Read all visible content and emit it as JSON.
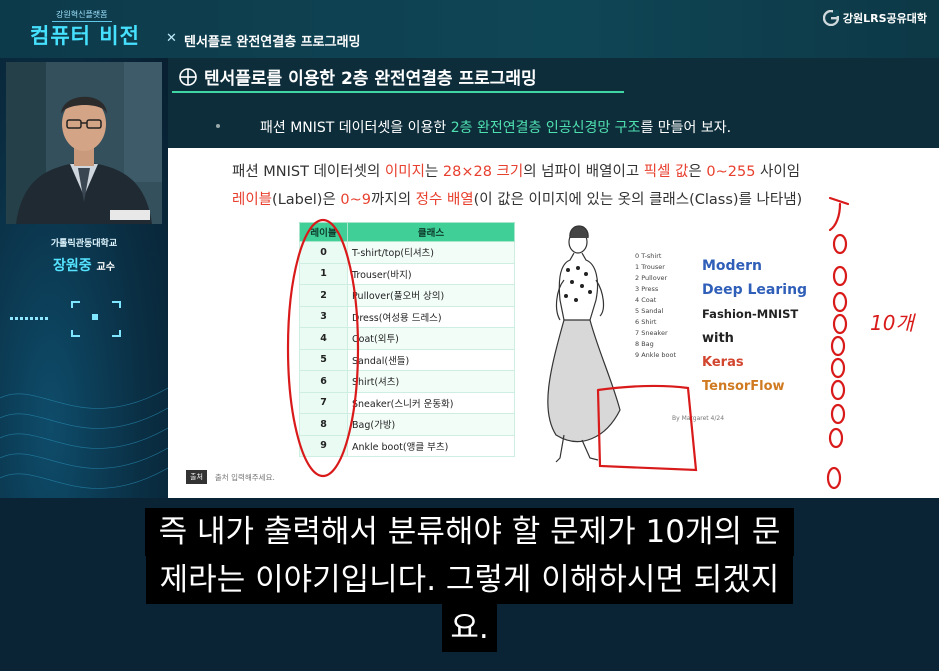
{
  "header": {
    "brand_small": "강원혁신플랫폼",
    "brand_big": "컴퓨터 비전",
    "lecture_prefix": "✕",
    "lecture_title": "텐서플로 완전연결층 프로그래밍",
    "org_name": "강원LRS공유대학",
    "org_icon": "g-logo-icon"
  },
  "presenter": {
    "university": "가톨릭관동대학교",
    "name": "장원중",
    "title_suffix": "교수"
  },
  "slide": {
    "title": "텐서플로를 이용한 2층 완전연결층 프로그래밍",
    "intro_before": "패션 MNIST 데이터셋을 이용한 ",
    "intro_hl": "2층 완전연결층 인공신경망 구조",
    "intro_after": "를 만들어 보자.",
    "desc1": {
      "a": "패션 MNIST 데이터셋의 ",
      "b": "이미지",
      "c": "는 ",
      "d": "28×28 크기",
      "e": "의 넘파이 배열이고 ",
      "f": "픽셀 값",
      "g": "은 ",
      "h": "0~255",
      "i": " 사이임"
    },
    "desc2": {
      "a": "레이블",
      "b": "(Label)은 ",
      "c": "0~9",
      "d": "까지의 ",
      "e": "정수 배열",
      "f": "(이 값은 이미지에 있는 옷의 클래스(Class)를 나타냄)"
    },
    "table": {
      "headers": [
        "레이블",
        "클래스"
      ],
      "rows": [
        {
          "label": "0",
          "class": "T-shirt/top(티셔츠)"
        },
        {
          "label": "1",
          "class": "Trouser(바지)"
        },
        {
          "label": "2",
          "class": "Pullover(풀오버 상의)"
        },
        {
          "label": "3",
          "class": "Dress(여성용 드레스)"
        },
        {
          "label": "4",
          "class": "Coat(외투)"
        },
        {
          "label": "5",
          "class": "Sandal(샌들)"
        },
        {
          "label": "6",
          "class": "Shirt(셔츠)"
        },
        {
          "label": "7",
          "class": "Sneaker(스니커 운동화)"
        },
        {
          "label": "8",
          "class": "Bag(가방)"
        },
        {
          "label": "9",
          "class": "Ankle boot(앵클 부츠)"
        }
      ]
    },
    "sketch": {
      "small_list": [
        "0 T-shirt",
        "1 Trouser",
        "2 Pullover",
        "3 Press",
        "4 Coat",
        "5 Sandal",
        "6 Shirt",
        "7 Sneaker",
        "8 Bag",
        "9 Ankle boot"
      ],
      "words": [
        "Modern",
        "Deep Learing",
        "Fashion-MNIST",
        "with",
        "Keras",
        "TensorFlow"
      ],
      "word_colors": [
        "#2f5fb8",
        "#2f5fb8",
        "#222222",
        "#222222",
        "#d2452f",
        "#d07a22"
      ],
      "credit": "By Margaret 4/24"
    },
    "source_badge": "출처",
    "source_text": "출처 입력해주세요.",
    "annotation_text": "10개"
  },
  "subtitle": {
    "line1": "즉 내가 출력해서 분류해야 할 문제가 10개의 문",
    "line2": "제라는 이야기입니다. 그렇게 이해하시면 되겠지",
    "line3": "요."
  },
  "colors": {
    "accent": "#46e1ff",
    "highlight_green": "#4fe0b0",
    "highlight_red": "#e8402f",
    "table_header": "#3fcf97",
    "annotation_red": "#d91a1a"
  }
}
